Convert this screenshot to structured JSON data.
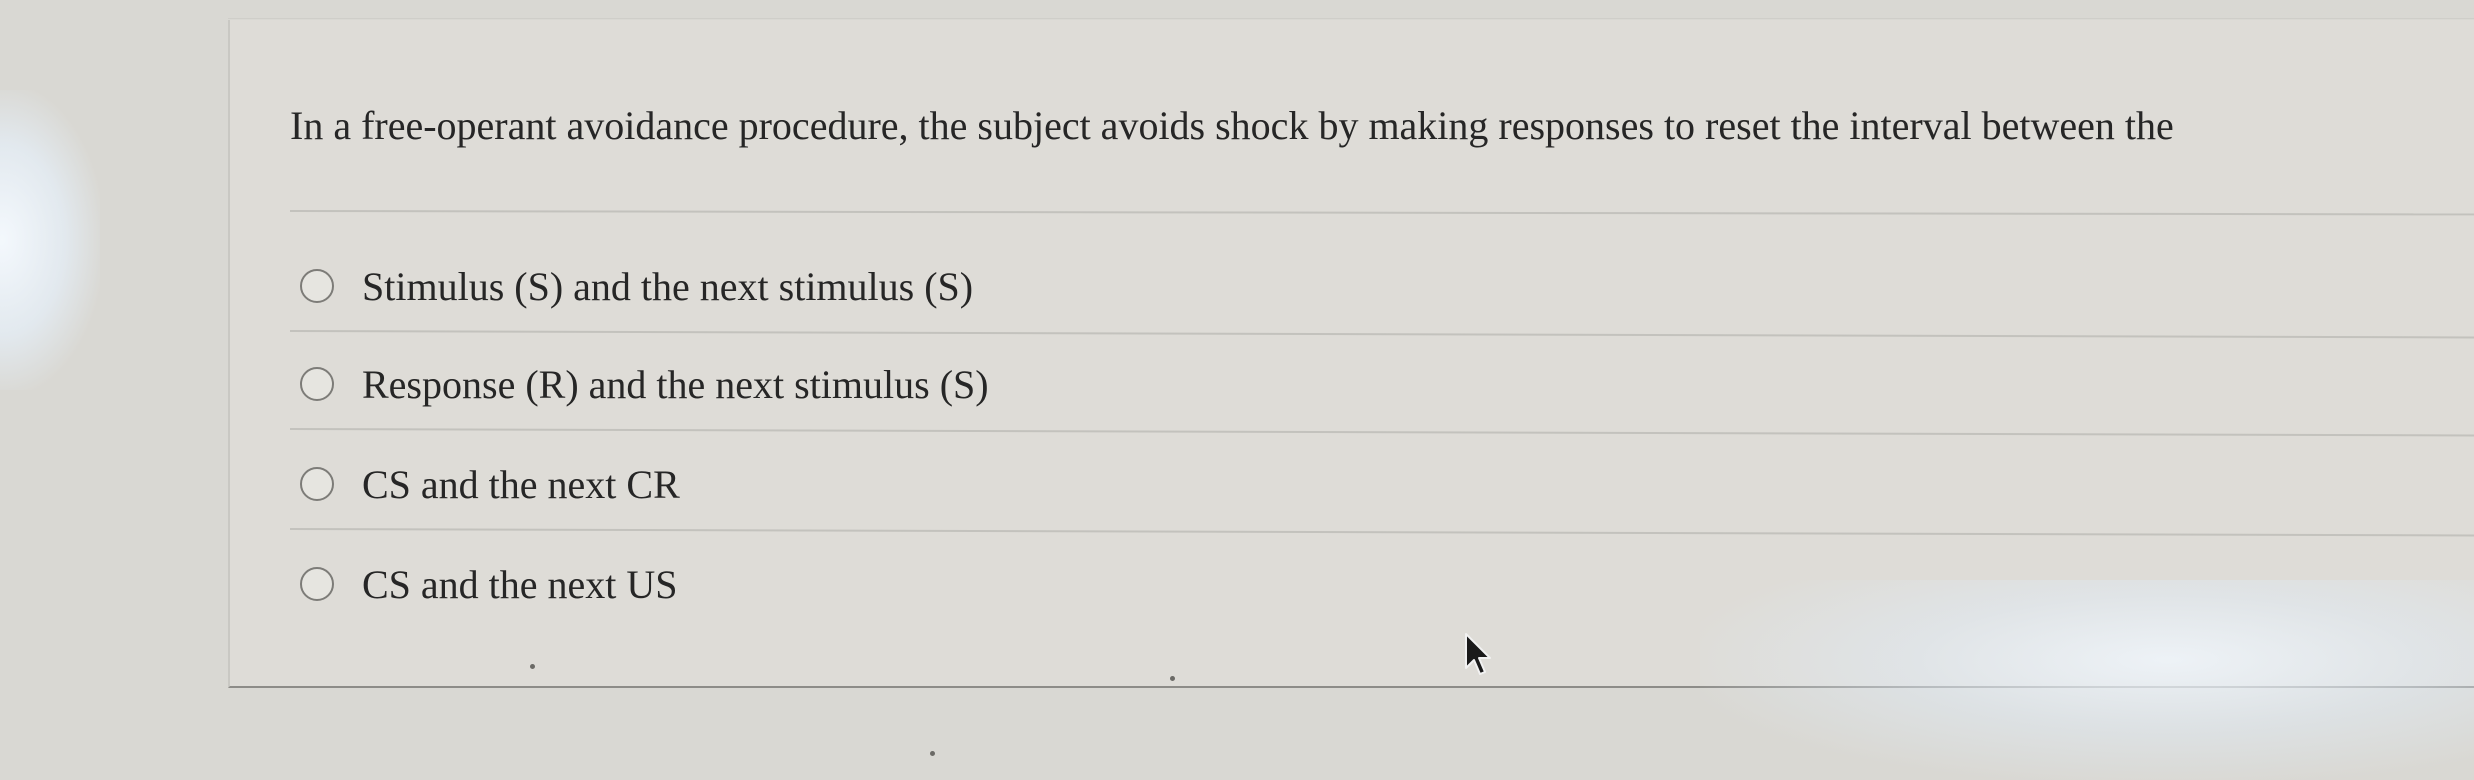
{
  "question": {
    "text": "In a free-operant avoidance procedure, the subject avoids shock by making responses to reset the interval between the"
  },
  "options": [
    {
      "label": "Stimulus (S) and the next stimulus (S)",
      "selected": false
    },
    {
      "label": "Response (R) and the next stimulus (S)",
      "selected": false
    },
    {
      "label": "CS and the next CR",
      "selected": false
    },
    {
      "label": "CS and the next US",
      "selected": false
    }
  ],
  "colors": {
    "background": "#d9d8d3",
    "text": "#262626",
    "radio_border": "#7d7c78"
  },
  "icons": {
    "cursor": "mouse-pointer-icon",
    "radio": "radio-unselected-icon"
  }
}
